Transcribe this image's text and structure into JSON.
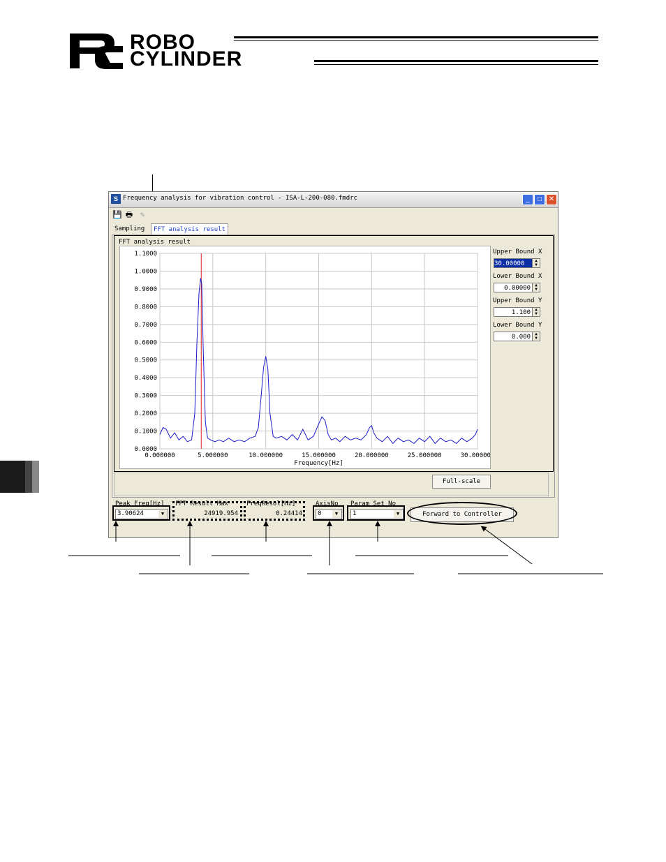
{
  "header": {
    "brand_line1": "ROBO",
    "brand_line2": "CYLINDER"
  },
  "window": {
    "title": "Frequency analysis for vibration control - ISA-L-200-080.fmdrc",
    "tabs": [
      "Sampling",
      "FFT analysis result"
    ],
    "group_title": "FFT analysis result",
    "bounds": {
      "upper_x_label": "Upper Bound X",
      "upper_x_value": "30.00000",
      "lower_x_label": "Lower Bound X",
      "lower_x_value": "0.00000",
      "upper_y_label": "Upper Bound Y",
      "upper_y_value": "1.100",
      "lower_y_label": "Lower Bound Y",
      "lower_y_value": "0.000"
    },
    "full_scale_label": "Full-scale",
    "bottom": {
      "peak_freq_label": "Peak Freq[Hz]",
      "peak_freq_value": "3.90624",
      "fft_max_label": "FFT Result Max",
      "fft_max_value": "24919.954",
      "freq_resol_label": "FreqResol[Hz]",
      "freq_resol_value": "0.24414",
      "axis_no_label": "AxisNo",
      "axis_no_value": "0",
      "param_set_label": "Param Set No",
      "param_set_value": "1",
      "forward_label": "Forward to Controller"
    }
  },
  "chart_data": {
    "type": "line",
    "xlabel": "Frequency[Hz]",
    "ylabel": "",
    "xlim": [
      0,
      30
    ],
    "ylim": [
      0,
      1.1
    ],
    "x_ticks": [
      "0.000000",
      "5.000000",
      "10.000000",
      "15.000000",
      "20.000000",
      "25.000000",
      "30.000000"
    ],
    "y_ticks": [
      "0.0000",
      "0.1000",
      "0.2000",
      "0.3000",
      "0.4000",
      "0.5000",
      "0.6000",
      "0.7000",
      "0.8000",
      "0.9000",
      "1.0000",
      "1.1000"
    ],
    "peak_marker_x": 3.90624,
    "series": [
      {
        "color": "#1a1acc",
        "x": [
          0,
          0.3,
          0.6,
          1.0,
          1.4,
          1.8,
          2.2,
          2.6,
          3.0,
          3.3,
          3.5,
          3.7,
          3.85,
          3.95,
          4.1,
          4.3,
          4.5,
          4.8,
          5.2,
          5.6,
          6.0,
          6.5,
          7.0,
          7.5,
          8.0,
          8.5,
          9.0,
          9.3,
          9.6,
          9.8,
          10.0,
          10.2,
          10.4,
          10.7,
          11.0,
          11.5,
          12.0,
          12.5,
          13.0,
          13.5,
          14.0,
          14.5,
          15.0,
          15.3,
          15.6,
          15.9,
          16.2,
          16.6,
          17.0,
          17.5,
          18.0,
          18.5,
          19.0,
          19.5,
          19.8,
          20.0,
          20.2,
          20.5,
          21.0,
          21.5,
          22.0,
          22.5,
          23.0,
          23.5,
          24.0,
          24.5,
          25.0,
          25.5,
          26.0,
          26.5,
          27.0,
          27.5,
          28.0,
          28.5,
          29.0,
          29.5,
          29.8,
          30.0
        ],
        "y": [
          0.08,
          0.12,
          0.11,
          0.06,
          0.09,
          0.05,
          0.07,
          0.04,
          0.05,
          0.2,
          0.6,
          0.88,
          0.96,
          0.93,
          0.55,
          0.15,
          0.06,
          0.05,
          0.04,
          0.05,
          0.04,
          0.06,
          0.04,
          0.05,
          0.04,
          0.06,
          0.07,
          0.12,
          0.32,
          0.46,
          0.52,
          0.45,
          0.2,
          0.07,
          0.06,
          0.07,
          0.05,
          0.08,
          0.05,
          0.11,
          0.05,
          0.07,
          0.14,
          0.18,
          0.16,
          0.08,
          0.05,
          0.06,
          0.04,
          0.07,
          0.05,
          0.06,
          0.05,
          0.08,
          0.12,
          0.13,
          0.09,
          0.06,
          0.04,
          0.07,
          0.03,
          0.06,
          0.04,
          0.05,
          0.03,
          0.06,
          0.04,
          0.07,
          0.03,
          0.06,
          0.04,
          0.05,
          0.03,
          0.06,
          0.04,
          0.06,
          0.08,
          0.11
        ]
      }
    ]
  }
}
